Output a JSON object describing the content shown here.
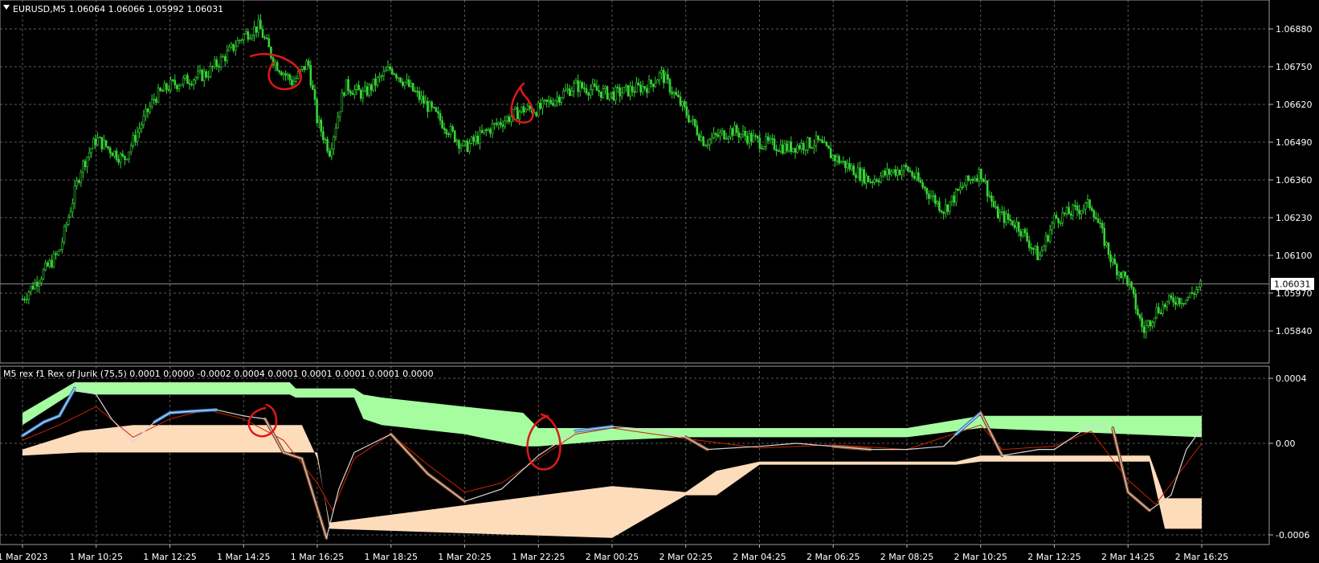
{
  "colors": {
    "background": "#000000",
    "grid": "#5a5a5a",
    "candle": "#35d435",
    "text": "#ffffff",
    "band_upper": "#a5fda0",
    "band_lower": "#fddcbc",
    "rex_line": "#d6d6d6",
    "signal_line": "#cc2200",
    "up_accent": "#2f7fd0",
    "down_accent": "#8a4a26",
    "annotation": "#e01818",
    "price_marker_bg": "#ffffff",
    "price_marker_text": "#000000"
  },
  "main_panel": {
    "title": "EURUSD,M5  1.06064 1.06066 1.05992 1.06031",
    "title_icon": "triangle-down-icon",
    "price_ticks": [
      "1.06880",
      "1.06750",
      "1.06620",
      "1.06490",
      "1.06360",
      "1.06230",
      "1.06100",
      "1.05970",
      "1.05840"
    ],
    "current_price": "1.06031"
  },
  "indicator_panel": {
    "title": "M5 rex f1 Rex of Jurik (75,5) 0.0001 0.0000 -0.0002 0.0004 0.0001 0.0001 0.0001 0.0001 0.0000",
    "ticks": [
      "0.0004",
      "0.00",
      "-0.0006"
    ]
  },
  "time_axis": {
    "labels": [
      "1 Mar 2023",
      "1 Mar 10:25",
      "1 Mar 12:25",
      "1 Mar 14:25",
      "1 Mar 16:25",
      "1 Mar 18:25",
      "1 Mar 20:25",
      "1 Mar 22:25",
      "2 Mar 00:25",
      "2 Mar 02:25",
      "2 Mar 04:25",
      "2 Mar 06:25",
      "2 Mar 08:25",
      "2 Mar 10:25",
      "2 Mar 12:25",
      "2 Mar 14:25",
      "2 Mar 16:25"
    ]
  },
  "chart_data": [
    {
      "type": "candlestick",
      "symbol": "EURUSD",
      "timeframe": "M5",
      "ylim": [
        1.0581,
        1.0694
      ],
      "close_path": [
        [
          "1 Mar 08:25",
          1.0598
        ],
        [
          "1 Mar 09:25",
          1.0614
        ],
        [
          "1 Mar 10:00",
          1.0642
        ],
        [
          "1 Mar 10:25",
          1.0652
        ],
        [
          "1 Mar 11:10",
          1.0645
        ],
        [
          "1 Mar 12:00",
          1.0666
        ],
        [
          "1 Mar 12:25",
          1.067
        ],
        [
          "1 Mar 13:25",
          1.0674
        ],
        [
          "1 Mar 14:00",
          1.0681
        ],
        [
          "1 Mar 14:25",
          1.0687
        ],
        [
          "1 Mar 14:50",
          1.069
        ],
        [
          "1 Mar 15:15",
          1.0678
        ],
        [
          "1 Mar 15:45",
          1.0671
        ],
        [
          "1 Mar 16:10",
          1.0678
        ],
        [
          "1 Mar 16:25",
          1.0658
        ],
        [
          "1 Mar 16:45",
          1.0648
        ],
        [
          "1 Mar 17:10",
          1.067
        ],
        [
          "1 Mar 17:40",
          1.0667
        ],
        [
          "1 Mar 18:25",
          1.0676
        ],
        [
          "1 Mar 19:25",
          1.0663
        ],
        [
          "1 Mar 20:25",
          1.0649
        ],
        [
          "1 Mar 21:10",
          1.0656
        ],
        [
          "1 Mar 22:00",
          1.0662
        ],
        [
          "1 Mar 22:25",
          1.0662
        ],
        [
          "1 Mar 23:25",
          1.067
        ],
        [
          "2 Mar 00:25",
          1.0667
        ],
        [
          "2 Mar 01:25",
          1.067
        ],
        [
          "2 Mar 01:45",
          1.0674
        ],
        [
          "2 Mar 02:25",
          1.0661
        ],
        [
          "2 Mar 02:55",
          1.0651
        ],
        [
          "2 Mar 03:40",
          1.0655
        ],
        [
          "2 Mar 04:25",
          1.0651
        ],
        [
          "2 Mar 05:10",
          1.0649
        ],
        [
          "2 Mar 06:00",
          1.0651
        ],
        [
          "2 Mar 06:25",
          1.0646
        ],
        [
          "2 Mar 07:25",
          1.0638
        ],
        [
          "2 Mar 08:00",
          1.0641
        ],
        [
          "2 Mar 08:25",
          1.0642
        ],
        [
          "2 Mar 09:25",
          1.0628
        ],
        [
          "2 Mar 10:00",
          1.0637
        ],
        [
          "2 Mar 10:25",
          1.0641
        ],
        [
          "2 Mar 10:50",
          1.0627
        ],
        [
          "2 Mar 11:25",
          1.0623
        ],
        [
          "2 Mar 12:00",
          1.0612
        ],
        [
          "2 Mar 12:25",
          1.0625
        ],
        [
          "2 Mar 13:25",
          1.063
        ],
        [
          "2 Mar 14:00",
          1.061
        ],
        [
          "2 Mar 14:25",
          1.0604
        ],
        [
          "2 Mar 14:50",
          1.0587
        ],
        [
          "2 Mar 15:10",
          1.0594
        ],
        [
          "2 Mar 15:40",
          1.0598
        ],
        [
          "2 Mar 16:00",
          1.0598
        ],
        [
          "2 Mar 16:25",
          1.0603
        ]
      ],
      "last": {
        "open": 1.06064,
        "high": 1.06066,
        "low": 1.05992,
        "close": 1.06031
      }
    },
    {
      "type": "line",
      "name": "Rex of Jurik (75,5)",
      "ylim": [
        -0.00066,
        0.00046
      ],
      "rex": [
        [
          "1 Mar 08:25",
          5e-05
        ],
        [
          "1 Mar 09:00",
          0.00014
        ],
        [
          "1 Mar 09:25",
          0.00018
        ],
        [
          "1 Mar 09:50",
          0.00036
        ],
        [
          "1 Mar 10:25",
          0.00032
        ],
        [
          "1 Mar 10:50",
          0.00016
        ],
        [
          "1 Mar 11:25",
          1e-05
        ],
        [
          "1 Mar 12:00",
          0.00014
        ],
        [
          "1 Mar 12:25",
          0.0002
        ],
        [
          "1 Mar 13:00",
          0.00021
        ],
        [
          "1 Mar 13:40",
          0.00022
        ],
        [
          "1 Mar 14:25",
          0.00018
        ],
        [
          "1 Mar 15:00",
          0.00016
        ],
        [
          "1 Mar 15:30",
          -6e-05
        ],
        [
          "1 Mar 16:00",
          -0.0001
        ],
        [
          "1 Mar 16:40",
          -0.00062
        ],
        [
          "1 Mar 17:00",
          -0.0003
        ],
        [
          "1 Mar 17:25",
          -6e-05
        ],
        [
          "1 Mar 18:25",
          6e-05
        ],
        [
          "1 Mar 19:25",
          -0.0002
        ],
        [
          "1 Mar 20:25",
          -0.00038
        ],
        [
          "1 Mar 21:25",
          -0.0003
        ],
        [
          "1 Mar 22:25",
          -8e-05
        ],
        [
          "1 Mar 23:25",
          8e-05
        ],
        [
          "2 Mar 00:25",
          0.00011
        ],
        [
          "2 Mar 01:25",
          9e-05
        ],
        [
          "2 Mar 02:25",
          4e-05
        ],
        [
          "2 Mar 03:00",
          -4e-05
        ],
        [
          "2 Mar 04:25",
          -2e-05
        ],
        [
          "2 Mar 05:25",
          0.0
        ],
        [
          "2 Mar 06:25",
          -2e-05
        ],
        [
          "2 Mar 07:25",
          -4e-05
        ],
        [
          "2 Mar 08:25",
          -4e-05
        ],
        [
          "2 Mar 09:25",
          -2e-05
        ],
        [
          "2 Mar 09:45",
          6e-05
        ],
        [
          "2 Mar 10:25",
          0.0002
        ],
        [
          "2 Mar 11:00",
          -8e-05
        ],
        [
          "2 Mar 12:00",
          -4e-05
        ],
        [
          "2 Mar 12:25",
          -4e-05
        ],
        [
          "2 Mar 13:25",
          0.00012
        ],
        [
          "2 Mar 14:00",
          0.0001
        ],
        [
          "2 Mar 14:25",
          -0.00032
        ],
        [
          "2 Mar 15:00",
          -0.00044
        ],
        [
          "2 Mar 15:35",
          -0.00034
        ],
        [
          "2 Mar 16:00",
          -4e-05
        ],
        [
          "2 Mar 16:25",
          0.0001
        ]
      ],
      "signal": [
        [
          "1 Mar 08:25",
          2e-05
        ],
        [
          "1 Mar 09:25",
          0.00012
        ],
        [
          "1 Mar 10:25",
          0.00024
        ],
        [
          "1 Mar 11:25",
          4e-05
        ],
        [
          "1 Mar 12:25",
          0.00016
        ],
        [
          "1 Mar 13:25",
          0.00022
        ],
        [
          "1 Mar 14:25",
          0.00016
        ],
        [
          "1 Mar 15:30",
          2e-05
        ],
        [
          "1 Mar 16:25",
          -0.00026
        ],
        [
          "1 Mar 16:50",
          -0.00044
        ],
        [
          "1 Mar 17:25",
          -0.0001
        ],
        [
          "1 Mar 18:25",
          6e-05
        ],
        [
          "1 Mar 19:25",
          -0.00014
        ],
        [
          "1 Mar 20:25",
          -0.00032
        ],
        [
          "1 Mar 21:25",
          -0.00026
        ],
        [
          "1 Mar 22:25",
          -0.0001
        ],
        [
          "1 Mar 23:25",
          6e-05
        ],
        [
          "2 Mar 00:25",
          0.0001
        ],
        [
          "2 Mar 02:25",
          3e-05
        ],
        [
          "2 Mar 04:25",
          -3e-05
        ],
        [
          "2 Mar 06:25",
          -1e-05
        ],
        [
          "2 Mar 08:25",
          -4e-05
        ],
        [
          "2 Mar 10:25",
          0.00012
        ],
        [
          "2 Mar 11:00",
          -4e-05
        ],
        [
          "2 Mar 12:25",
          -2e-05
        ],
        [
          "2 Mar 13:25",
          8e-05
        ],
        [
          "2 Mar 14:25",
          -0.00024
        ],
        [
          "2 Mar 15:10",
          -0.0004
        ],
        [
          "2 Mar 16:25",
          0.0
        ]
      ],
      "upper_band": [
        [
          "1 Mar 08:25",
          0.0002,
          0.00012
        ],
        [
          "1 Mar 09:50",
          0.0004,
          0.00034
        ],
        [
          "1 Mar 10:25",
          0.0004,
          0.00032
        ],
        [
          "1 Mar 15:40",
          0.0004,
          0.00032
        ],
        [
          "1 Mar 15:50",
          0.00036,
          0.0003
        ],
        [
          "1 Mar 17:25",
          0.00036,
          0.0003
        ],
        [
          "1 Mar 17:40",
          0.00032,
          0.00016
        ],
        [
          "1 Mar 18:10",
          0.0003,
          0.00012
        ],
        [
          "1 Mar 20:25",
          0.00024,
          6e-05
        ],
        [
          "1 Mar 22:00",
          0.0002,
          -2e-05
        ],
        [
          "1 Mar 22:25",
          0.0001,
          -2e-05
        ],
        [
          "2 Mar 00:25",
          0.0001,
          2e-05
        ],
        [
          "2 Mar 02:25",
          0.0001,
          4e-05
        ],
        [
          "2 Mar 06:25",
          0.0001,
          4e-05
        ],
        [
          "2 Mar 08:25",
          0.0001,
          4e-05
        ],
        [
          "2 Mar 10:25",
          0.00018,
          0.0001
        ],
        [
          "2 Mar 14:25",
          0.00018,
          6e-05
        ],
        [
          "2 Mar 16:25",
          0.00018,
          4e-05
        ]
      ],
      "lower_band": [
        [
          "1 Mar 08:25",
          -8e-05,
          -4e-05
        ],
        [
          "1 Mar 10:00",
          -6e-05,
          8e-05
        ],
        [
          "1 Mar 11:25",
          -6e-05,
          0.00012
        ],
        [
          "1 Mar 16:00",
          -6e-05,
          0.00012
        ],
        [
          "1 Mar 16:25",
          -6e-05,
          -0.0001
        ],
        [
          "1 Mar 16:45",
          -0.00056,
          -0.00052
        ],
        [
          "2 Mar 00:25",
          -0.00062,
          -0.00028
        ],
        [
          "2 Mar 02:25",
          -0.00034,
          -0.00032
        ],
        [
          "2 Mar 03:15",
          -0.00034,
          -0.00018
        ],
        [
          "2 Mar 04:25",
          -0.00014,
          -0.00012
        ],
        [
          "2 Mar 06:25",
          -0.00014,
          -0.00012
        ],
        [
          "2 Mar 09:45",
          -0.00014,
          -0.00012
        ],
        [
          "2 Mar 10:25",
          -0.00012,
          -8e-05
        ],
        [
          "2 Mar 15:00",
          -0.00012,
          -8e-05
        ],
        [
          "2 Mar 15:25",
          -0.00056,
          -0.00036
        ],
        [
          "2 Mar 16:25",
          -0.00056,
          -0.00036
        ]
      ]
    }
  ]
}
